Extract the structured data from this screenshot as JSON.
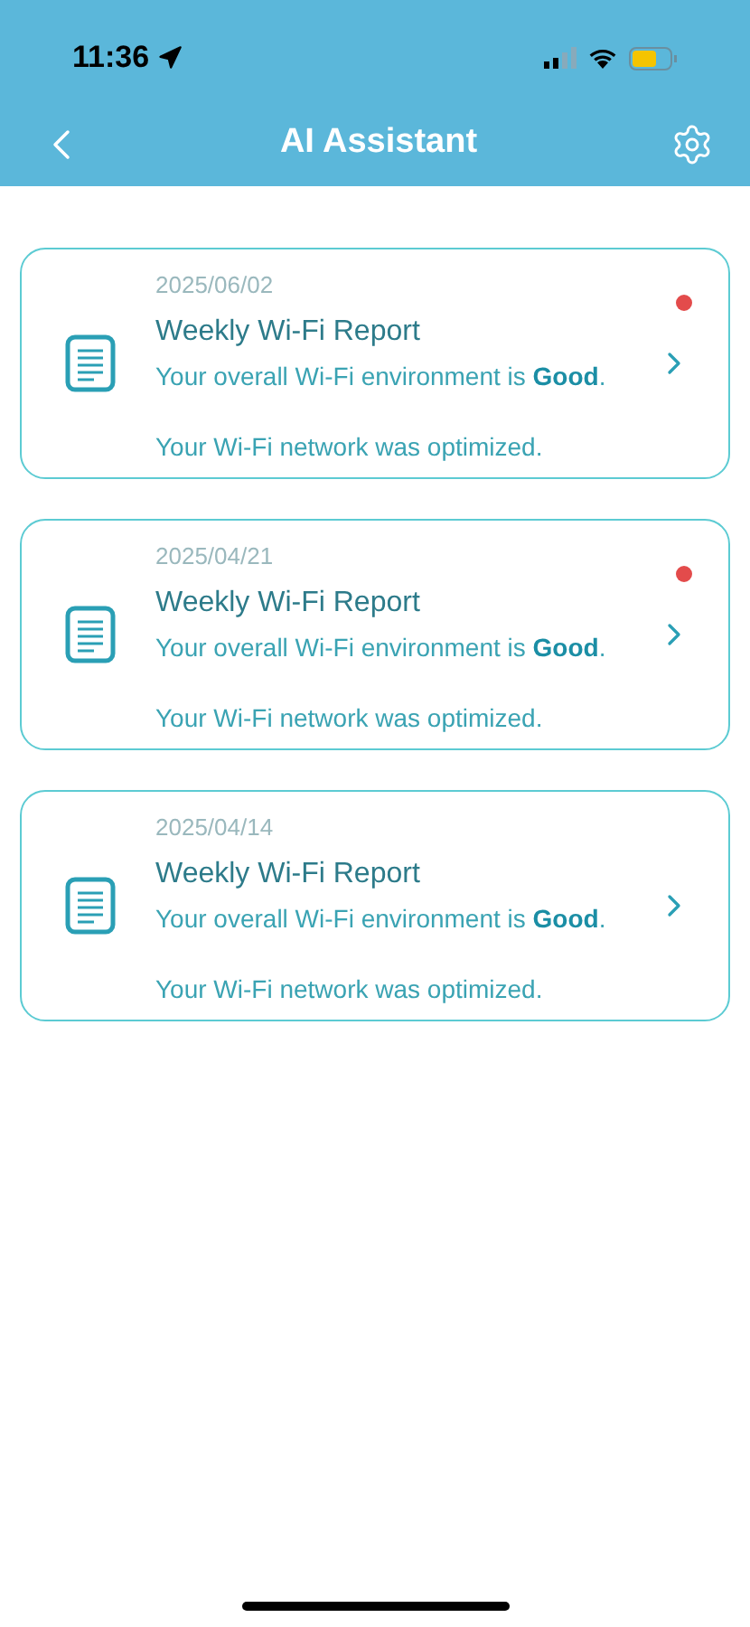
{
  "status_bar": {
    "time": "11:36"
  },
  "header": {
    "title": "AI Assistant"
  },
  "reports": [
    {
      "date": "2025/06/02",
      "title": "Weekly Wi-Fi Report",
      "summary": "Your overall Wi-Fi environment is **Good**.",
      "note": "Your Wi-Fi network was optimized.",
      "unread": true
    },
    {
      "date": "2025/04/21",
      "title": "Weekly Wi-Fi Report",
      "summary": "Your overall Wi-Fi environment is **Good**.",
      "note": "Your Wi-Fi network was optimized.",
      "unread": true
    },
    {
      "date": "2025/04/14",
      "title": "Weekly Wi-Fi Report",
      "summary": "Your overall Wi-Fi environment is **Good**.",
      "note": "Your Wi-Fi network was optimized.",
      "unread": false
    }
  ]
}
